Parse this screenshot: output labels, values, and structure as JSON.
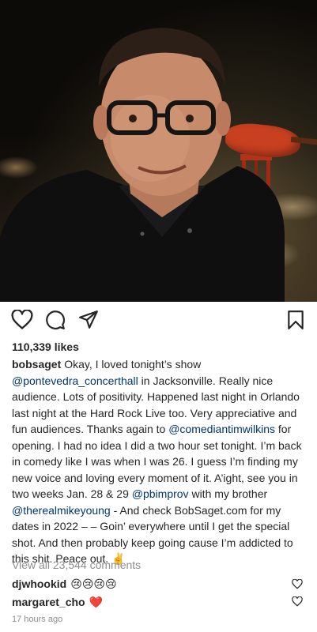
{
  "post": {
    "likes": "110,339 likes",
    "caption": {
      "username": "bobsaget",
      "segments": [
        {
          "t": "Okay, I loved tonight’s show ",
          "m": false
        },
        {
          "t": "@pontevedra_concerthall",
          "m": true
        },
        {
          "t": " in Jacksonville. Really nice audience. Lots of positivity. Happened last night in Orlando last night at the Hard Rock Live too. Very appreciative and fun audiences. Thanks again to ",
          "m": false
        },
        {
          "t": "@comediantimwilkins",
          "m": true
        },
        {
          "t": " for opening. I had no idea I did a two hour set tonight. I’m back in comedy like I was when I was 26. I guess I’m finding my new voice and loving every moment of it. A’ight, see you in two weeks Jan. 28 & 29 ",
          "m": false
        },
        {
          "t": "@pbimprov",
          "m": true
        },
        {
          "t": " with my brother ",
          "m": false
        },
        {
          "t": "@therealmikeyoung",
          "m": true
        },
        {
          "t": " - And check BobSaget.com for my dates in 2022 – – Goin’ everywhere until I get the special shot. And then probably keep going cause I’m addicted to this shit. Peace out. ✌️",
          "m": false
        }
      ]
    },
    "view_all_comments": "View all 23,544 comments",
    "comments": [
      {
        "username": "djwhookid",
        "text": "😢😢😢😢"
      },
      {
        "username": "margaret_cho",
        "text": "❤️"
      }
    ],
    "timestamp": "17 hours ago"
  },
  "icons": {
    "like": "heart-outline-icon",
    "comment": "speech-bubble-icon",
    "share": "paper-plane-icon",
    "save": "bookmark-icon"
  },
  "colors": {
    "text": "#262626",
    "mention": "#00376b",
    "muted": "#8e8e8e"
  }
}
